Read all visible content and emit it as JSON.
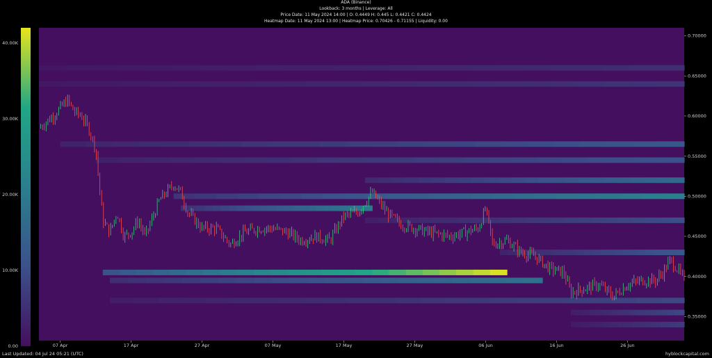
{
  "header": {
    "title": "ADA (Binance)",
    "lookback": "Lookback: 3 months | Leverage: All",
    "price_info": "Price Date: 11 May 2024 14:00 | O: 0.4449 H: 0.445 L: 0.4421 C: 0.4424",
    "heatmap_info": "Heatmap Date: 11 May 2024 13:00 | Heatmap Price: 0.70426 - 0.71155 | Liquidity: 0.00"
  },
  "footer": {
    "last_updated": "Last Updated: 04 Jul 24 05:21 (UTC)",
    "brand": "hyblockcapital.com"
  },
  "colors": {
    "background": "#440f5e",
    "low": "#440f5e",
    "mid": "#2a7f8e",
    "high": "#21a685",
    "max": "#e6e51c",
    "candle_up": "#32d27a",
    "candle_down": "#ff4a4a"
  },
  "chart_data": {
    "type": "heatmap",
    "title": "ADA (Binance)",
    "colorbar": {
      "ticks": [
        "0.00",
        "10.00K",
        "20.00K",
        "30.00K",
        "40.00K"
      ],
      "range": [
        0,
        42000
      ]
    },
    "y_axis": {
      "ticks": [
        "0.35000",
        "0.40000",
        "0.45000",
        "0.50000",
        "0.55000",
        "0.60000",
        "0.65000",
        "0.70000"
      ],
      "range": [
        0.32,
        0.71
      ]
    },
    "x_axis": {
      "ticks": [
        "07 Apr",
        "17 Apr",
        "27 Apr",
        "07 May",
        "17 May",
        "27 May",
        "06 Jun",
        "16 Jun",
        "26 Jun"
      ],
      "range": [
        "2024-04-04",
        "2024-07-04"
      ]
    },
    "price_path": [
      [
        "2024-04-04",
        0.585
      ],
      [
        "2024-04-06",
        0.6
      ],
      [
        "2024-04-08",
        0.62
      ],
      [
        "2024-04-09",
        0.605
      ],
      [
        "2024-04-10",
        0.6
      ],
      [
        "2024-04-11",
        0.585
      ],
      [
        "2024-04-12",
        0.56
      ],
      [
        "2024-04-13",
        0.47
      ],
      [
        "2024-04-14",
        0.455
      ],
      [
        "2024-04-15",
        0.48
      ],
      [
        "2024-04-16",
        0.45
      ],
      [
        "2024-04-17",
        0.455
      ],
      [
        "2024-04-18",
        0.47
      ],
      [
        "2024-04-19",
        0.45
      ],
      [
        "2024-04-21",
        0.495
      ],
      [
        "2024-04-23",
        0.515
      ],
      [
        "2024-04-24",
        0.505
      ],
      [
        "2024-04-25",
        0.48
      ],
      [
        "2024-04-27",
        0.46
      ],
      [
        "2024-04-29",
        0.46
      ],
      [
        "2024-05-01",
        0.44
      ],
      [
        "2024-05-03",
        0.455
      ],
      [
        "2024-05-05",
        0.46
      ],
      [
        "2024-05-07",
        0.46
      ],
      [
        "2024-05-09",
        0.455
      ],
      [
        "2024-05-11",
        0.445
      ],
      [
        "2024-05-13",
        0.45
      ],
      [
        "2024-05-15",
        0.445
      ],
      [
        "2024-05-17",
        0.475
      ],
      [
        "2024-05-19",
        0.48
      ],
      [
        "2024-05-21",
        0.505
      ],
      [
        "2024-05-23",
        0.48
      ],
      [
        "2024-05-25",
        0.465
      ],
      [
        "2024-05-27",
        0.46
      ],
      [
        "2024-05-29",
        0.455
      ],
      [
        "2024-06-01",
        0.45
      ],
      [
        "2024-06-03",
        0.455
      ],
      [
        "2024-06-05",
        0.46
      ],
      [
        "2024-06-06",
        0.485
      ],
      [
        "2024-06-07",
        0.44
      ],
      [
        "2024-06-09",
        0.445
      ],
      [
        "2024-06-11",
        0.43
      ],
      [
        "2024-06-13",
        0.425
      ],
      [
        "2024-06-15",
        0.41
      ],
      [
        "2024-06-17",
        0.405
      ],
      [
        "2024-06-18",
        0.38
      ],
      [
        "2024-06-20",
        0.385
      ],
      [
        "2024-06-22",
        0.39
      ],
      [
        "2024-06-24",
        0.375
      ],
      [
        "2024-06-26",
        0.39
      ],
      [
        "2024-06-28",
        0.395
      ],
      [
        "2024-06-30",
        0.395
      ],
      [
        "2024-07-01",
        0.405
      ],
      [
        "2024-07-02",
        0.42
      ],
      [
        "2024-07-03",
        0.41
      ],
      [
        "2024-07-04",
        0.395
      ]
    ],
    "liquidity_bands": [
      {
        "price": 0.405,
        "start": "2024-04-13",
        "end": "2024-06-09",
        "peak_end": "2024-06-09",
        "max": 42000
      },
      {
        "price": 0.5,
        "start": "2024-04-23",
        "end": "2024-07-04",
        "max": 22000
      },
      {
        "price": 0.52,
        "start": "2024-05-20",
        "end": "2024-07-04",
        "max": 16000
      },
      {
        "price": 0.485,
        "start": "2024-04-24",
        "end": "2024-05-21",
        "max": 20000
      },
      {
        "price": 0.395,
        "start": "2024-04-14",
        "end": "2024-06-14",
        "max": 18000
      },
      {
        "price": 0.565,
        "start": "2024-04-07",
        "end": "2024-07-04",
        "max": 12000
      },
      {
        "price": 0.545,
        "start": "2024-04-12",
        "end": "2024-07-04",
        "max": 11000
      },
      {
        "price": 0.47,
        "start": "2024-05-20",
        "end": "2024-07-04",
        "max": 10000
      },
      {
        "price": 0.43,
        "start": "2024-06-08",
        "end": "2024-07-04",
        "max": 12000
      },
      {
        "price": 0.37,
        "start": "2024-04-14",
        "end": "2024-07-04",
        "max": 9000
      },
      {
        "price": 0.355,
        "start": "2024-06-18",
        "end": "2024-07-04",
        "max": 9000
      },
      {
        "price": 0.34,
        "start": "2024-06-18",
        "end": "2024-07-04",
        "max": 7000
      },
      {
        "price": 0.64,
        "start": "2024-04-04",
        "end": "2024-07-04",
        "max": 6000
      },
      {
        "price": 0.66,
        "start": "2024-04-04",
        "end": "2024-07-04",
        "max": 5000
      }
    ]
  }
}
